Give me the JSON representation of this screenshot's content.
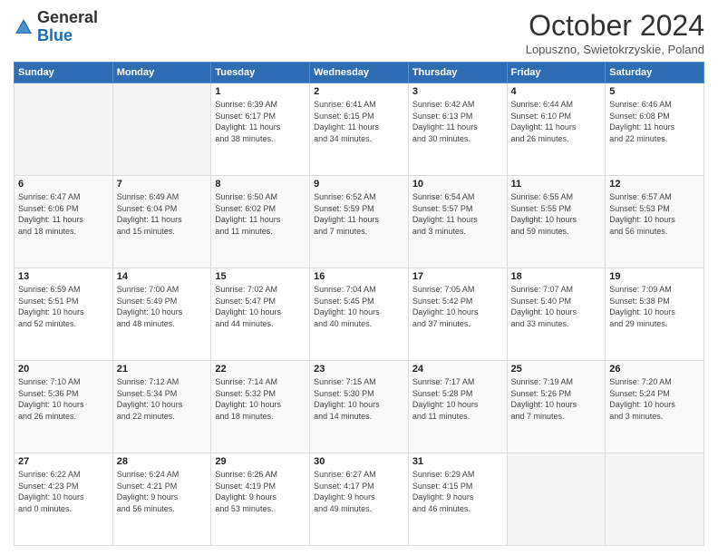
{
  "header": {
    "logo_general": "General",
    "logo_blue": "Blue",
    "month_title": "October 2024",
    "location": "Lopuszno, Swietokrzyskie, Poland"
  },
  "weekdays": [
    "Sunday",
    "Monday",
    "Tuesday",
    "Wednesday",
    "Thursday",
    "Friday",
    "Saturday"
  ],
  "weeks": [
    [
      {
        "day": "",
        "info": ""
      },
      {
        "day": "",
        "info": ""
      },
      {
        "day": "1",
        "info": "Sunrise: 6:39 AM\nSunset: 6:17 PM\nDaylight: 11 hours\nand 38 minutes."
      },
      {
        "day": "2",
        "info": "Sunrise: 6:41 AM\nSunset: 6:15 PM\nDaylight: 11 hours\nand 34 minutes."
      },
      {
        "day": "3",
        "info": "Sunrise: 6:42 AM\nSunset: 6:13 PM\nDaylight: 11 hours\nand 30 minutes."
      },
      {
        "day": "4",
        "info": "Sunrise: 6:44 AM\nSunset: 6:10 PM\nDaylight: 11 hours\nand 26 minutes."
      },
      {
        "day": "5",
        "info": "Sunrise: 6:46 AM\nSunset: 6:08 PM\nDaylight: 11 hours\nand 22 minutes."
      }
    ],
    [
      {
        "day": "6",
        "info": "Sunrise: 6:47 AM\nSunset: 6:06 PM\nDaylight: 11 hours\nand 18 minutes."
      },
      {
        "day": "7",
        "info": "Sunrise: 6:49 AM\nSunset: 6:04 PM\nDaylight: 11 hours\nand 15 minutes."
      },
      {
        "day": "8",
        "info": "Sunrise: 6:50 AM\nSunset: 6:02 PM\nDaylight: 11 hours\nand 11 minutes."
      },
      {
        "day": "9",
        "info": "Sunrise: 6:52 AM\nSunset: 5:59 PM\nDaylight: 11 hours\nand 7 minutes."
      },
      {
        "day": "10",
        "info": "Sunrise: 6:54 AM\nSunset: 5:57 PM\nDaylight: 11 hours\nand 3 minutes."
      },
      {
        "day": "11",
        "info": "Sunrise: 6:55 AM\nSunset: 5:55 PM\nDaylight: 10 hours\nand 59 minutes."
      },
      {
        "day": "12",
        "info": "Sunrise: 6:57 AM\nSunset: 5:53 PM\nDaylight: 10 hours\nand 56 minutes."
      }
    ],
    [
      {
        "day": "13",
        "info": "Sunrise: 6:59 AM\nSunset: 5:51 PM\nDaylight: 10 hours\nand 52 minutes."
      },
      {
        "day": "14",
        "info": "Sunrise: 7:00 AM\nSunset: 5:49 PM\nDaylight: 10 hours\nand 48 minutes."
      },
      {
        "day": "15",
        "info": "Sunrise: 7:02 AM\nSunset: 5:47 PM\nDaylight: 10 hours\nand 44 minutes."
      },
      {
        "day": "16",
        "info": "Sunrise: 7:04 AM\nSunset: 5:45 PM\nDaylight: 10 hours\nand 40 minutes."
      },
      {
        "day": "17",
        "info": "Sunrise: 7:05 AM\nSunset: 5:42 PM\nDaylight: 10 hours\nand 37 minutes."
      },
      {
        "day": "18",
        "info": "Sunrise: 7:07 AM\nSunset: 5:40 PM\nDaylight: 10 hours\nand 33 minutes."
      },
      {
        "day": "19",
        "info": "Sunrise: 7:09 AM\nSunset: 5:38 PM\nDaylight: 10 hours\nand 29 minutes."
      }
    ],
    [
      {
        "day": "20",
        "info": "Sunrise: 7:10 AM\nSunset: 5:36 PM\nDaylight: 10 hours\nand 26 minutes."
      },
      {
        "day": "21",
        "info": "Sunrise: 7:12 AM\nSunset: 5:34 PM\nDaylight: 10 hours\nand 22 minutes."
      },
      {
        "day": "22",
        "info": "Sunrise: 7:14 AM\nSunset: 5:32 PM\nDaylight: 10 hours\nand 18 minutes."
      },
      {
        "day": "23",
        "info": "Sunrise: 7:15 AM\nSunset: 5:30 PM\nDaylight: 10 hours\nand 14 minutes."
      },
      {
        "day": "24",
        "info": "Sunrise: 7:17 AM\nSunset: 5:28 PM\nDaylight: 10 hours\nand 11 minutes."
      },
      {
        "day": "25",
        "info": "Sunrise: 7:19 AM\nSunset: 5:26 PM\nDaylight: 10 hours\nand 7 minutes."
      },
      {
        "day": "26",
        "info": "Sunrise: 7:20 AM\nSunset: 5:24 PM\nDaylight: 10 hours\nand 3 minutes."
      }
    ],
    [
      {
        "day": "27",
        "info": "Sunrise: 6:22 AM\nSunset: 4:23 PM\nDaylight: 10 hours\nand 0 minutes."
      },
      {
        "day": "28",
        "info": "Sunrise: 6:24 AM\nSunset: 4:21 PM\nDaylight: 9 hours\nand 56 minutes."
      },
      {
        "day": "29",
        "info": "Sunrise: 6:26 AM\nSunset: 4:19 PM\nDaylight: 9 hours\nand 53 minutes."
      },
      {
        "day": "30",
        "info": "Sunrise: 6:27 AM\nSunset: 4:17 PM\nDaylight: 9 hours\nand 49 minutes."
      },
      {
        "day": "31",
        "info": "Sunrise: 6:29 AM\nSunset: 4:15 PM\nDaylight: 9 hours\nand 46 minutes."
      },
      {
        "day": "",
        "info": ""
      },
      {
        "day": "",
        "info": ""
      }
    ]
  ]
}
